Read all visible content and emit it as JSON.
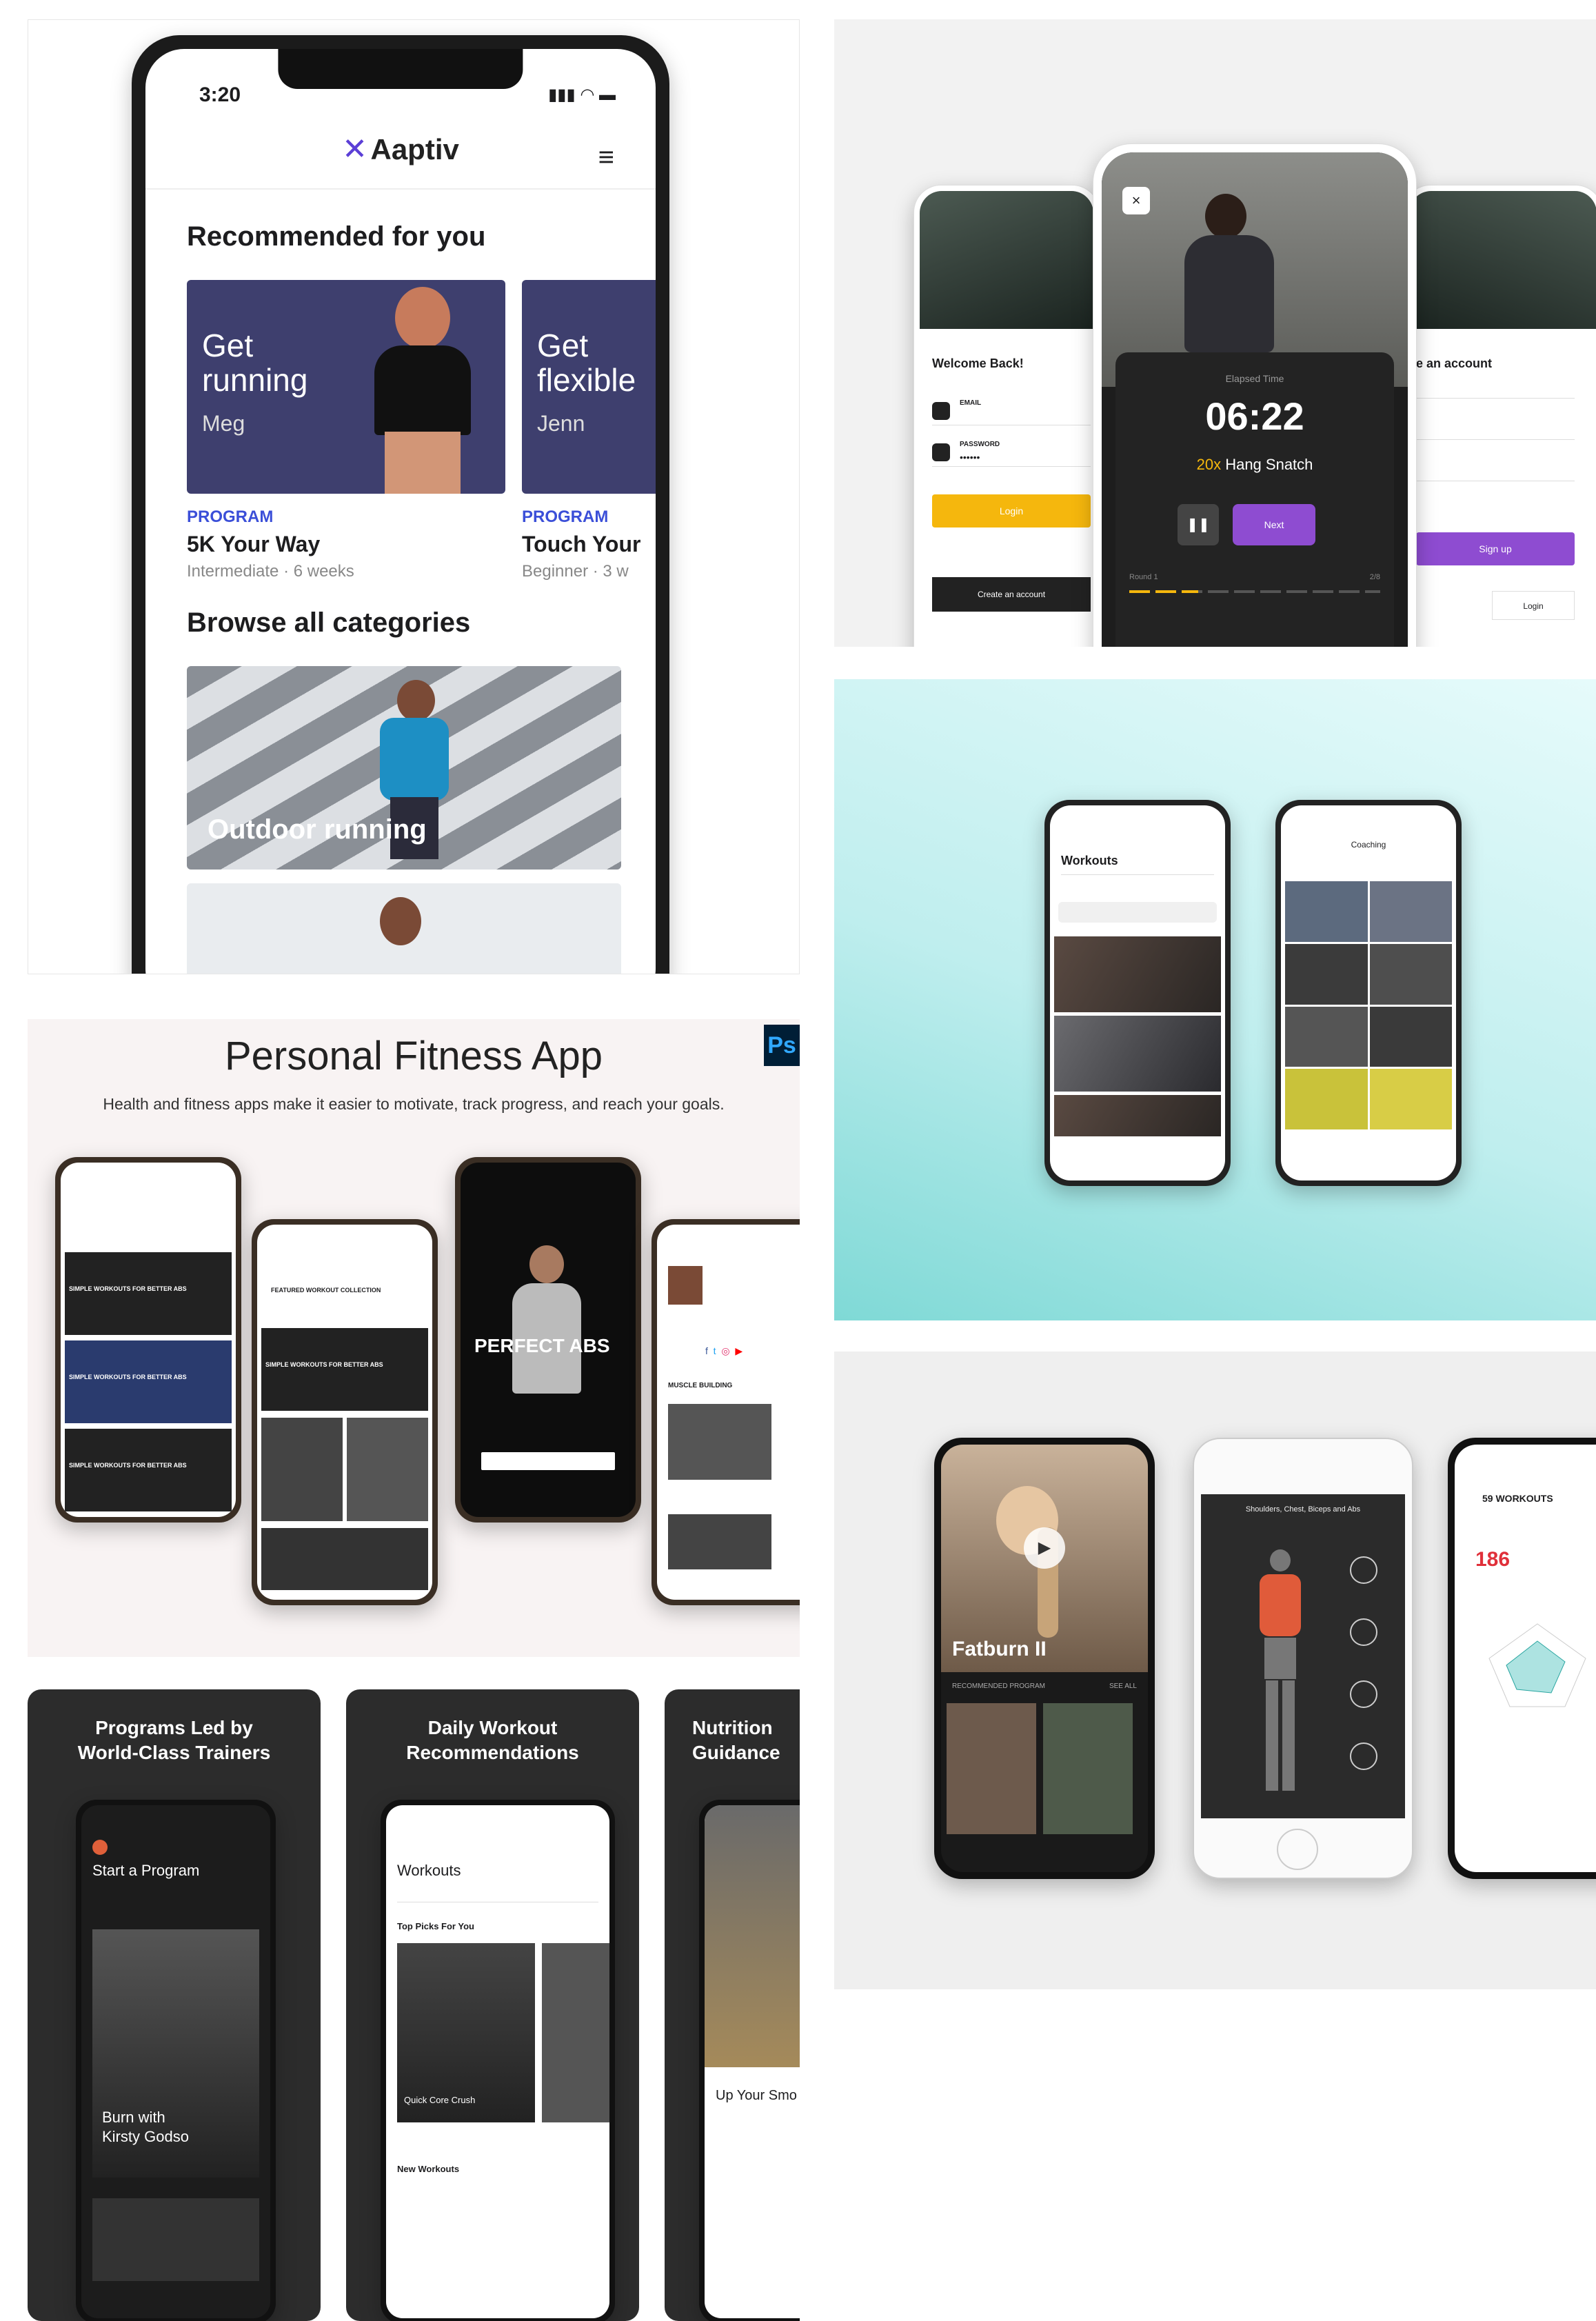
{
  "aaptiv": {
    "status_time": "3:20",
    "brand": "Aaptiv",
    "recommended_title": "Recommended for you",
    "cards": [
      {
        "title_line1": "Get",
        "title_line2": "running",
        "trainer": "Meg",
        "tag": "PROGRAM",
        "name": "5K Your Way",
        "meta": "Intermediate · 6 weeks"
      },
      {
        "title_line1": "Get",
        "title_line2": "flexible",
        "trainer": "Jenn",
        "tag": "PROGRAM",
        "name": "Touch Your",
        "meta": "Beginner · 3 w"
      }
    ],
    "browse_title": "Browse all categories",
    "category": "Outdoor running"
  },
  "workout_timer": {
    "welcome": "Welcome Back!",
    "email_label": "EMAIL",
    "password_label": "PASSWORD",
    "password_mask": "••••••",
    "login_button": "Login",
    "create_account": "Create an account",
    "timer_label": "Elapsed Time",
    "timer": "06:22",
    "exercise_count": "20x",
    "exercise_name": "Hang Snatch",
    "next_button": "Next",
    "round_label": "Round 1",
    "round_count": "2/8",
    "signup_title": "e an account",
    "signup_button": "Sign up",
    "login_link": "Login"
  },
  "teal_pair": {
    "left_title": "Workouts",
    "right_title": "Coaching"
  },
  "fitness_app": {
    "title": "Personal Fitness App",
    "subtitle": "Health and fitness apps make it easier to motivate, track progress, and reach your goals.",
    "ps_badge": "Ps",
    "perfect_abs": "PERFECT ABS",
    "muscle_building": "MUSCLE BUILDING",
    "workout_card": "SIMPLE WORKOUTS FOR BETTER ABS",
    "featured": "FEATURED WORKOUT COLLECTION"
  },
  "anatomy": {
    "video_title": "Fatburn II",
    "recommended": "RECOMMENDED PROGRAM",
    "see_all": "SEE ALL",
    "muscle_title": "Shoulders, Chest, Biceps and Abs",
    "score": "186",
    "workouts": "59 WORKOUTS"
  },
  "store": [
    {
      "header_line1": "Programs Led by",
      "header_line2": "World-Class Trainers",
      "screen_title": "Start a Program",
      "card_title_line1": "Burn with",
      "card_title_line2": "Kirsty Godso"
    },
    {
      "header_line1": "Daily Workout",
      "header_line2": "Recommendations",
      "screen_title": "Workouts",
      "section": "Top Picks For You",
      "item": "Quick Core Crush",
      "new_section": "New Workouts"
    },
    {
      "header_line1": "Nutrition",
      "header_line2": "Guidance",
      "screen_title": "Up Your Smo"
    }
  ]
}
